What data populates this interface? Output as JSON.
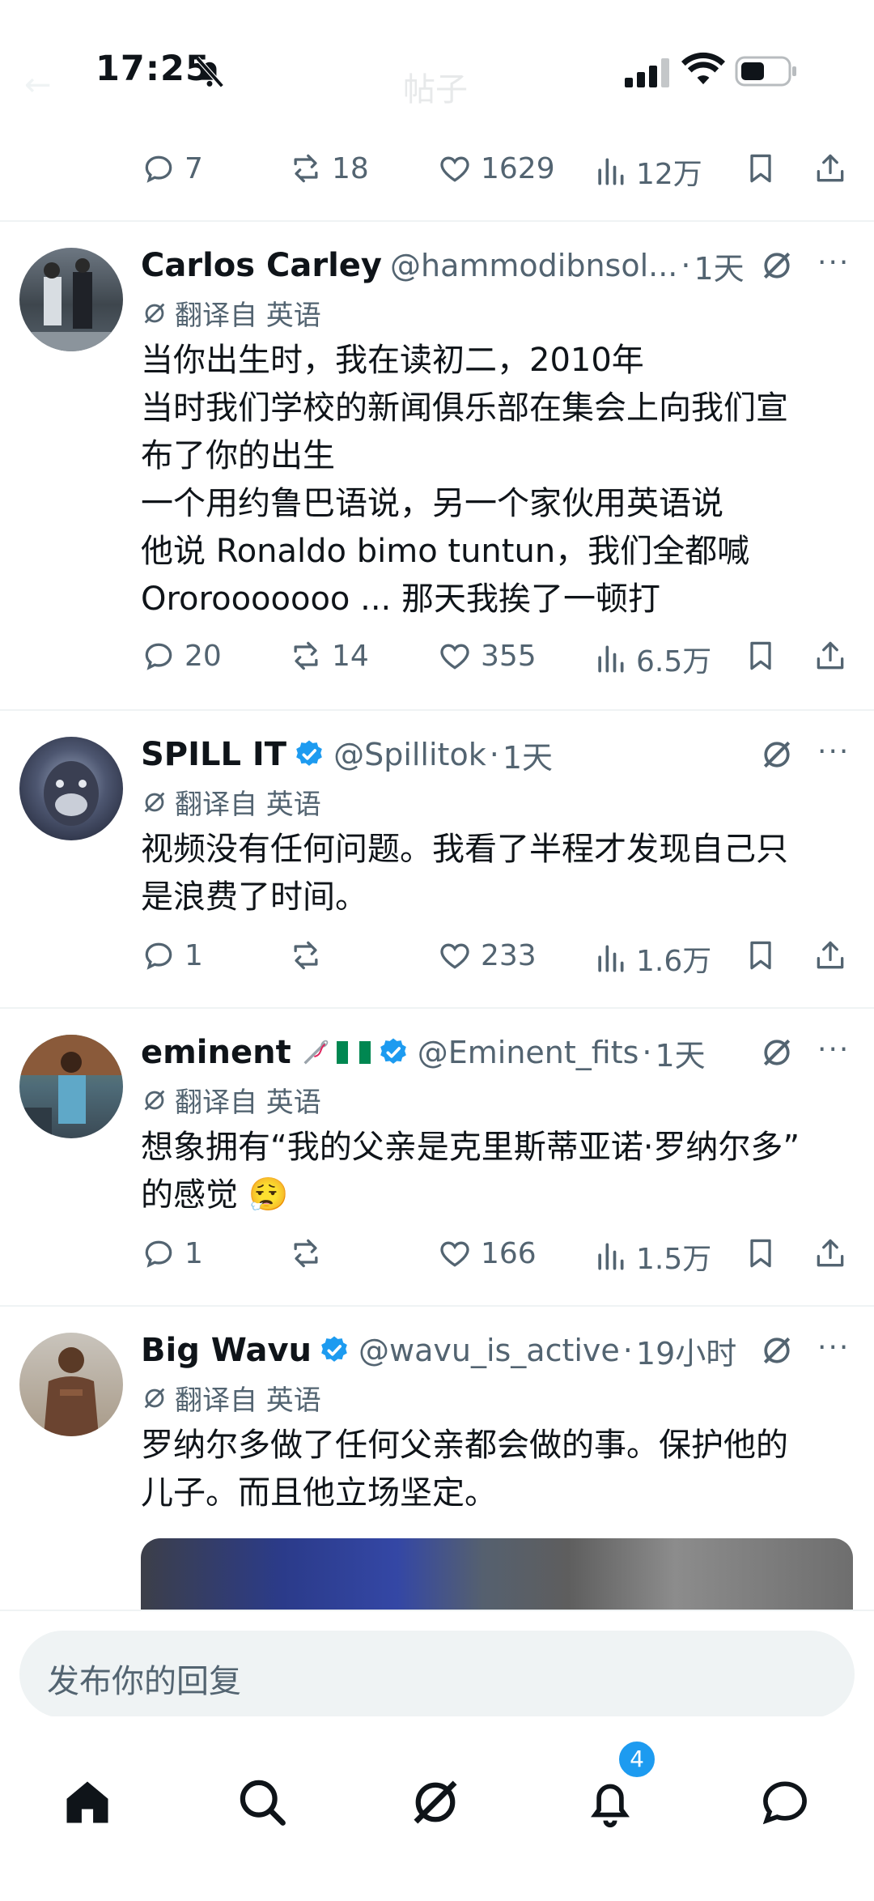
{
  "status_bar": {
    "time": "17:25",
    "header_title_faded": "帖子"
  },
  "top_actions": {
    "replies": "7",
    "reposts": "18",
    "likes": "1629",
    "views": "12万"
  },
  "tweets": [
    {
      "name": "Carlos Carley",
      "handle": "@hammodibnsol...",
      "time": "1天",
      "verified": false,
      "translated_label": "翻译自 英语",
      "lines": [
        "当你出生时，我在读初二，2010年",
        "当时我们学校的新闻俱乐部在集会上向我们宣",
        "布了你的出生",
        "一个用约鲁巴语说，另一个家伙用英语说",
        "他说 Ronaldo bimo tuntun，我们全都喊",
        "Ororooooooo ... 那天我挨了一顿打"
      ],
      "stats": {
        "replies": "20",
        "reposts": "14",
        "likes": "355",
        "views": "6.5万"
      }
    },
    {
      "name": "SPILL IT",
      "handle": "@Spillitok",
      "time": "1天",
      "verified": true,
      "translated_label": "翻译自 英语",
      "lines": [
        "视频没有任何问题。我看了半程才发现自己只",
        "是浪费了时间。"
      ],
      "stats": {
        "replies": "1",
        "reposts": "",
        "likes": "233",
        "views": "1.6万"
      }
    },
    {
      "name": "eminent",
      "name_emoji": "🪡🇳🇬",
      "handle": "@Eminent_fits",
      "time": "1天",
      "verified": true,
      "translated_label": "翻译自 英语",
      "lines": [
        "想象拥有“我的父亲是克里斯蒂亚诺·罗纳尔多”",
        "的感觉 😮‍💨"
      ],
      "stats": {
        "replies": "1",
        "reposts": "",
        "likes": "166",
        "views": "1.5万"
      }
    },
    {
      "name": "Big Wavu",
      "handle": "@wavu_is_active",
      "time": "19小时",
      "verified": true,
      "translated_label": "翻译自 英语",
      "lines": [
        "罗纳尔多做了任何父亲都会做的事。保护他的",
        "儿子。而且他立场坚定。"
      ]
    }
  ],
  "reply_box": {
    "placeholder": "发布你的回复"
  },
  "bottom_nav": {
    "notifications_badge": "4"
  },
  "colors": {
    "accent": "#1d9bf0",
    "secondary_text": "#536471",
    "primary_text": "#0f1419"
  }
}
